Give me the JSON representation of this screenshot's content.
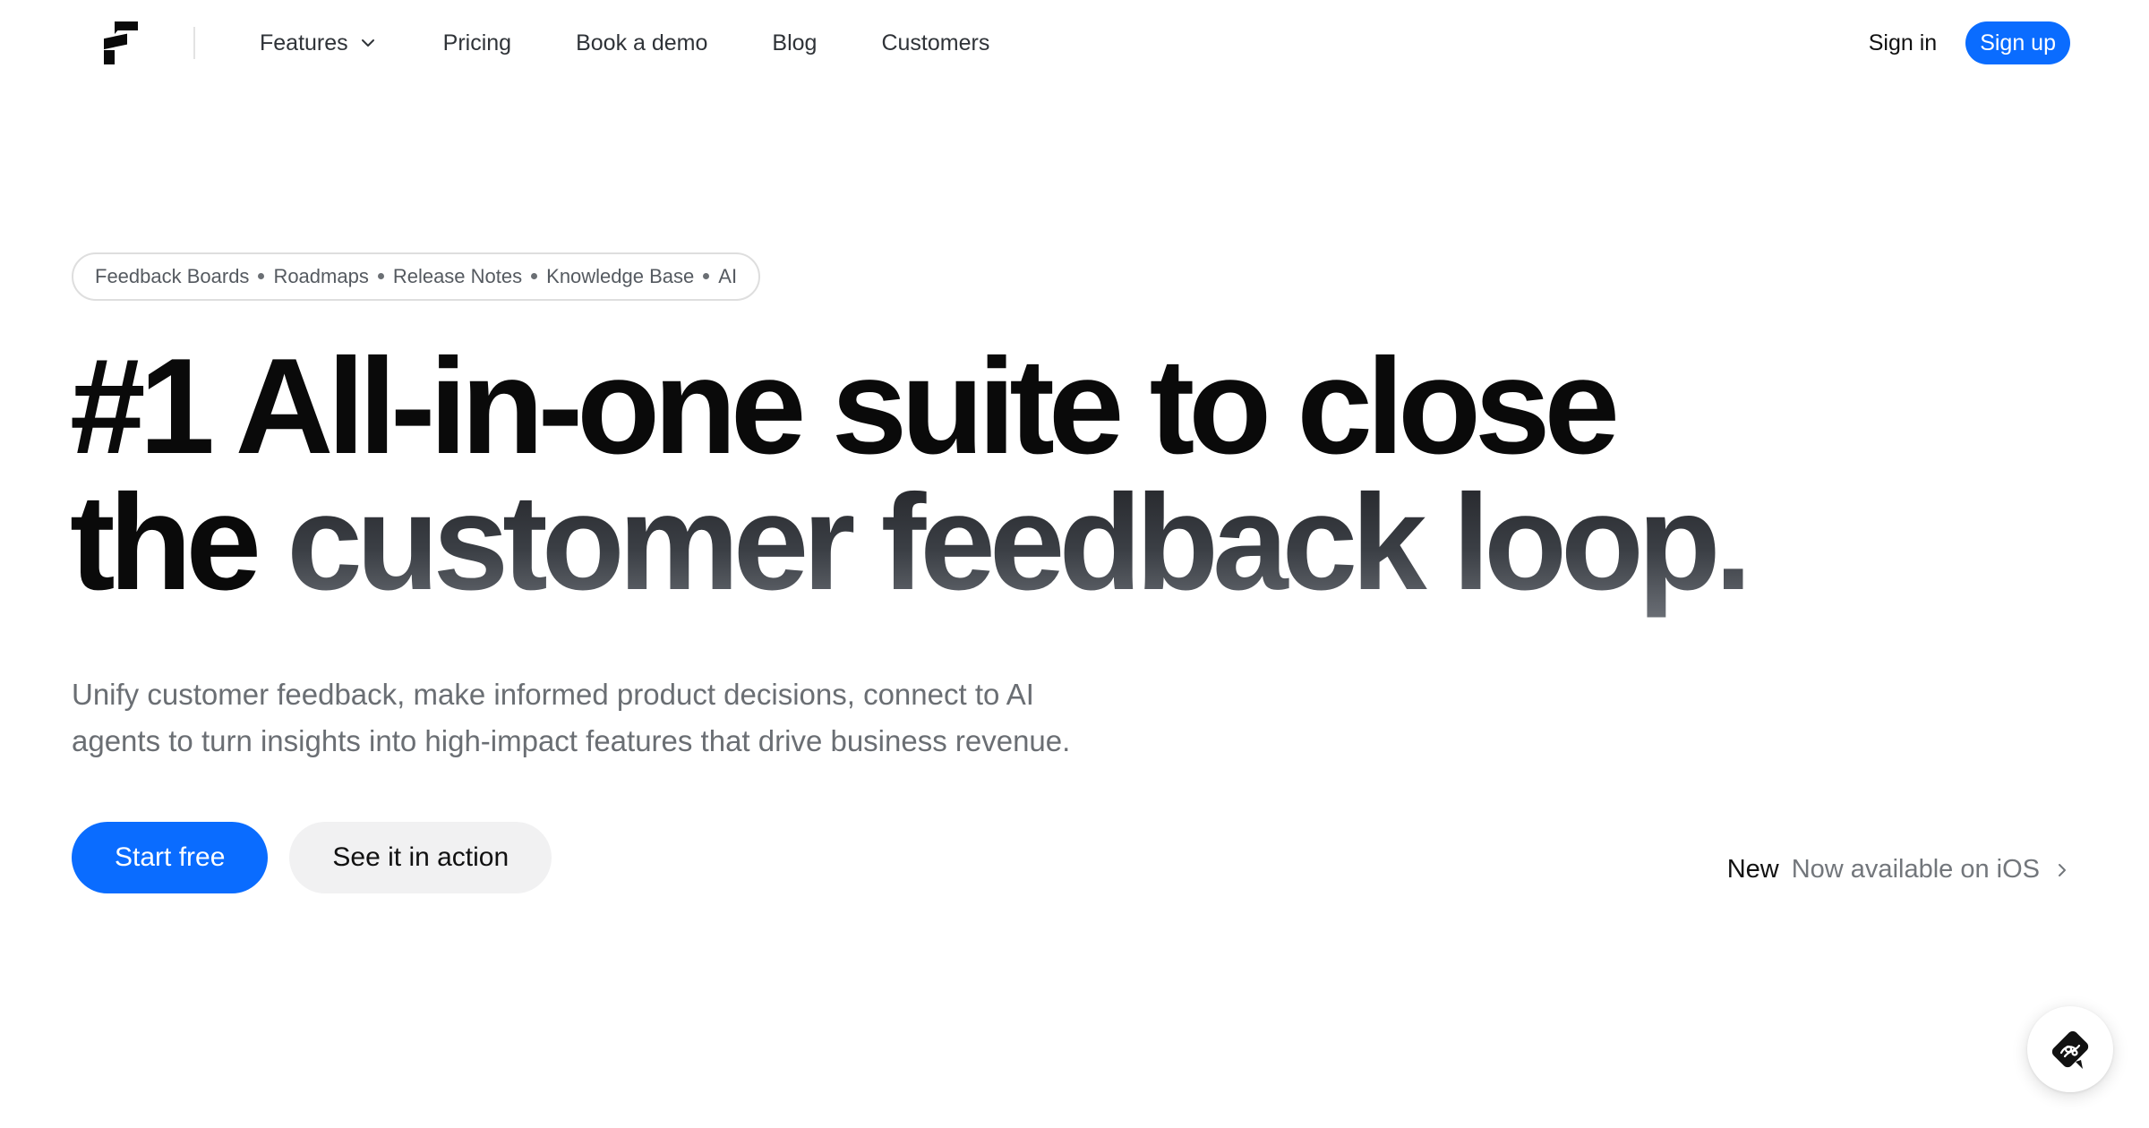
{
  "header": {
    "logo_icon": "featurebase-logo-icon",
    "nav": [
      {
        "label": "Features",
        "has_dropdown": true
      },
      {
        "label": "Pricing"
      },
      {
        "label": "Book a demo"
      },
      {
        "label": "Blog"
      },
      {
        "label": "Customers"
      }
    ],
    "sign_in": "Sign in",
    "sign_up": "Sign up"
  },
  "hero": {
    "tags": [
      "Feedback Boards",
      "Roadmaps",
      "Release Notes",
      "Knowledge Base",
      "AI"
    ],
    "headline": {
      "line1": "#1 All-in-one suite to close",
      "line2_plain": "the ",
      "line2_gradient": "customer feedback loop."
    },
    "subtitle_line1": "Unify customer feedback, make informed product decisions, connect to AI",
    "subtitle_line2": "agents to turn insights into high-impact features that drive business revenue.",
    "primary_cta": "Start free",
    "secondary_cta": "See it in action",
    "banner": {
      "new_label": "New",
      "text": "Now available on iOS"
    }
  },
  "widget": {
    "icon": "chat-support-icon"
  },
  "colors": {
    "accent": "#0a6cff",
    "text": "#0a0a0a",
    "muted": "#6a6e73",
    "secondary_button_bg": "#f1f1f2",
    "border": "#dedede"
  }
}
